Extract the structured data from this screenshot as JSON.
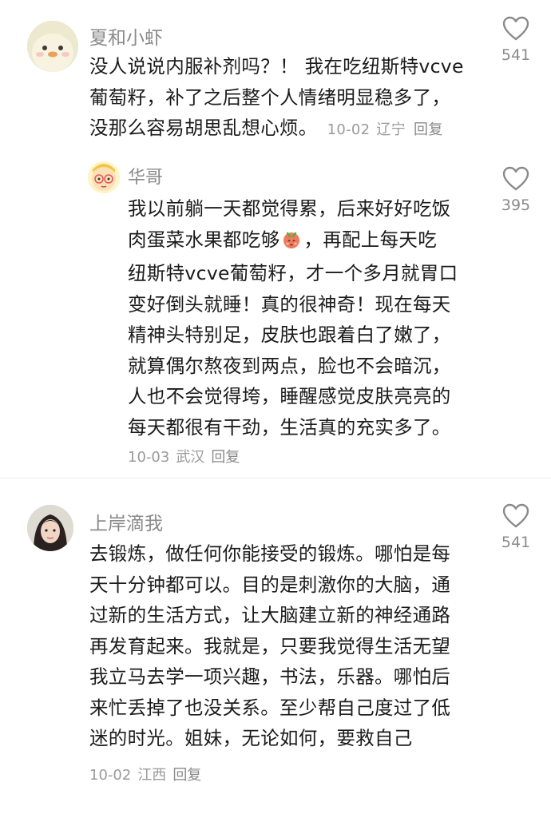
{
  "comments": [
    {
      "username": "夏和小虾",
      "lines": [
        "没人说说内服补剂吗？！ 我在吃纽斯特vcve",
        "葡萄籽，补了之后整个人情绪明显稳多了，",
        "没那么容易胡思乱想心烦。"
      ],
      "date": "10-02",
      "location": "辽宁",
      "reply_label": "回复",
      "likes": "541",
      "avatar_icon": "duck-avatar"
    },
    {
      "username": "华哥",
      "lines": [
        "我以前躺一天都觉得累，后来好好吃饭",
        "肉蛋菜水果都吃够",
        "，再配上每天吃",
        "纽斯特vcve葡萄籽，才一个多月就胃口",
        "变好倒头就睡！真的很神奇！现在每天",
        "精神头特别足，皮肤也跟着白了嫩了，",
        "就算偶尔熬夜到两点，脸也不会暗沉，",
        "人也不会觉得垮，睡醒感觉皮肤亮亮的",
        "每天都很有干劲，生活真的充实多了。"
      ],
      "date": "10-03",
      "location": "武汉",
      "reply_label": "回复",
      "likes": "395",
      "avatar_icon": "cartoon-glasses-avatar",
      "inline_emoji": "blush-face-emoji"
    },
    {
      "username": "上岸滴我",
      "lines": [
        "去锻炼，做任何你能接受的锻炼。哪怕是每",
        "天十分钟都可以。目的是刺激你的大脑，通",
        "过新的生活方式，让大脑建立新的神经通路",
        "再发育起来。我就是，只要我觉得生活无望",
        "我立马去学一项兴趣，书法，乐器。哪怕后",
        "来忙丢掉了也没关系。至少帮自己度过了低",
        "迷的时光。姐妹，无论如何，要救自己"
      ],
      "date": "10-02",
      "location": "江西",
      "reply_label": "回复",
      "likes": "541",
      "avatar_icon": "person-photo-avatar"
    }
  ],
  "colors": {
    "text": "#1b1b1b",
    "secondary": "#8a8a8a",
    "divider": "#ececec"
  }
}
